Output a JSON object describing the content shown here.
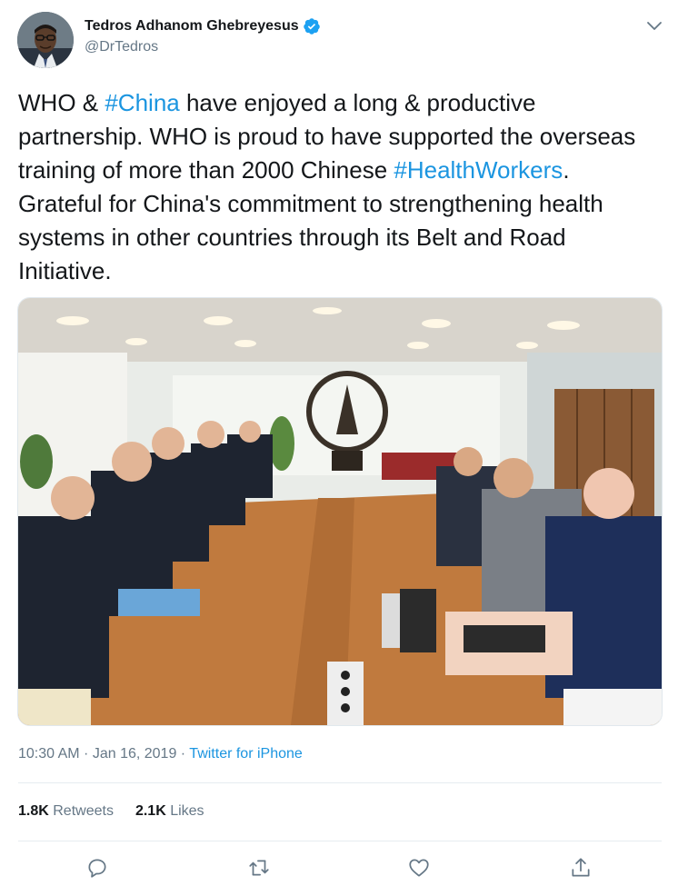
{
  "author": {
    "name": "Tedros Adhanom Ghebreyesus",
    "handle": "@DrTedros",
    "verified_icon": "verified-badge-icon",
    "avatar_icon": "avatar"
  },
  "tweet": {
    "segments": [
      {
        "text": "WHO & ",
        "hashtag": false
      },
      {
        "text": "#China",
        "hashtag": true
      },
      {
        "text": " have enjoyed a long & productive partnership. WHO is proud to have supported the overseas training of more than 2000 Chinese ",
        "hashtag": false
      },
      {
        "text": "#HealthWorkers",
        "hashtag": true
      },
      {
        "text": ". Grateful for China's commitment to strengthening health systems in other countries through its Belt and Road Initiative.",
        "hashtag": false
      }
    ]
  },
  "meta": {
    "time": "10:30 AM",
    "date": "Jan 16, 2019",
    "separator": " · ",
    "source": "Twitter for iPhone"
  },
  "stats": {
    "retweets_count": "1.8K",
    "retweets_label": "Retweets",
    "likes_count": "2.1K",
    "likes_label": "Likes"
  },
  "actions": [
    {
      "name": "reply-icon"
    },
    {
      "name": "retweet-icon"
    },
    {
      "name": "like-icon"
    },
    {
      "name": "share-icon"
    }
  ],
  "colors": {
    "hashtag": "#1b95e0",
    "secondary_text": "#657786",
    "verified": "#1da1f2"
  }
}
